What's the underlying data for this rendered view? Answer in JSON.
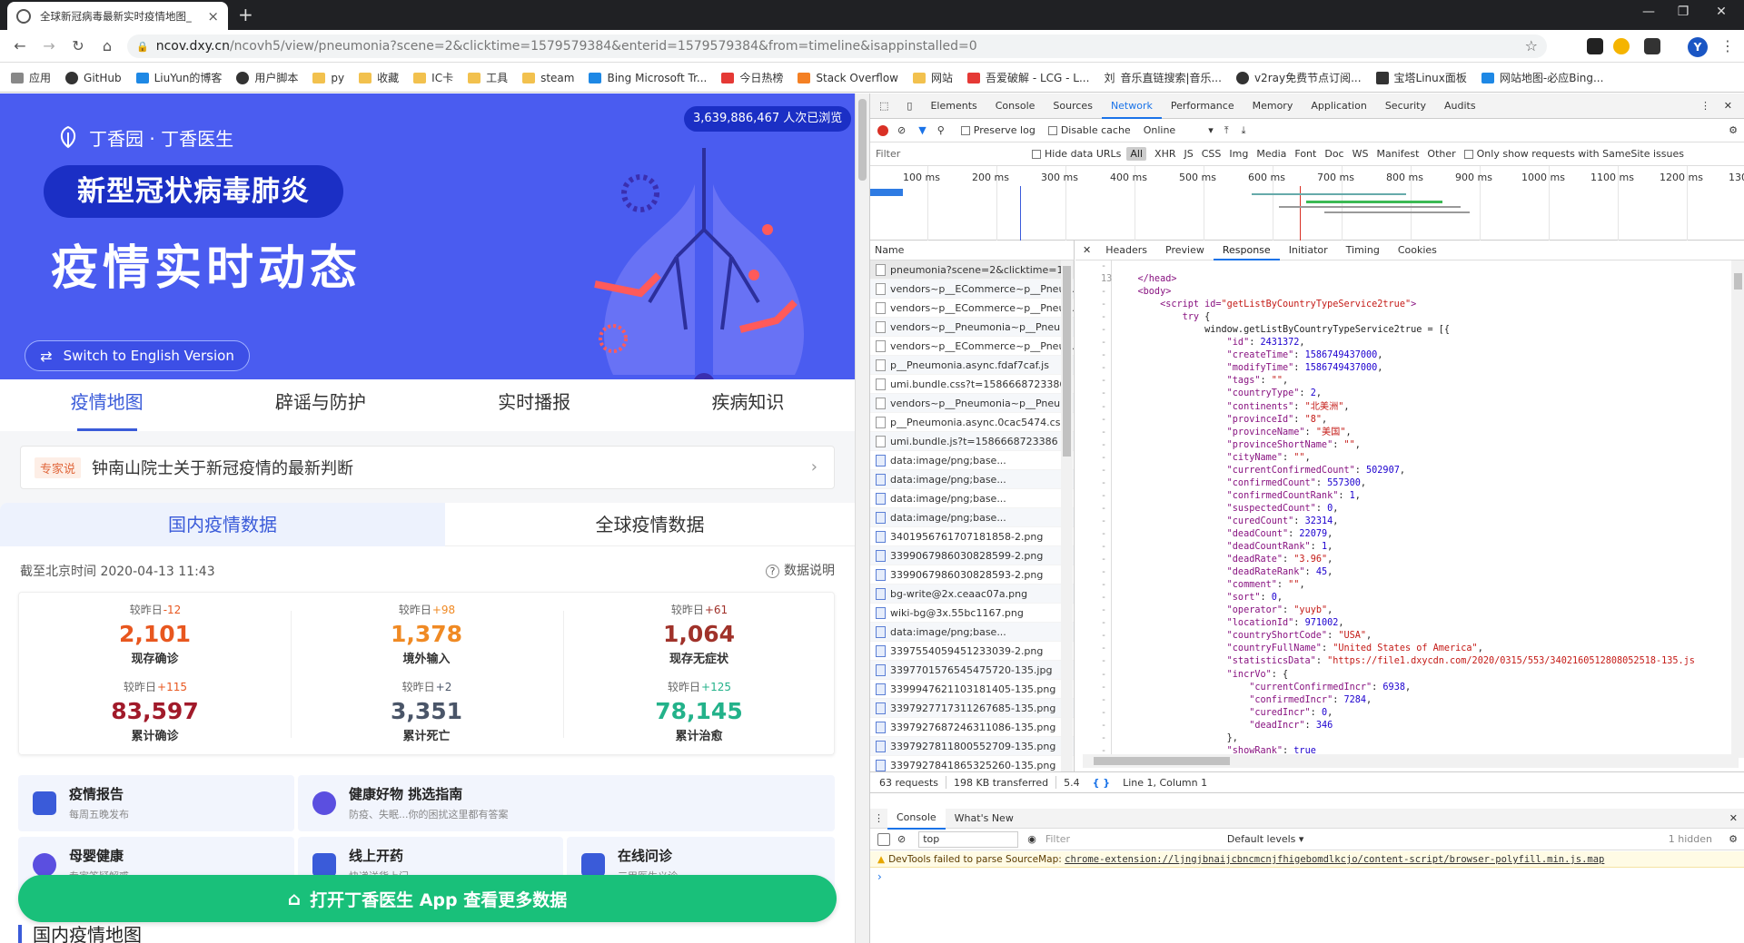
{
  "browser": {
    "tab_title": "全球新冠病毒最新实时疫情地图_",
    "url_host": "ncov.dxy.cn",
    "url_rest": "/ncovh5/view/pneumonia?scene=2&clicktime=1579579384&enterid=1579579384&from=timeline&isappinstalled=0",
    "avatar_letter": "Y",
    "bookmarks": [
      "应用",
      "GitHub",
      "LiuYun的博客",
      "用户脚本",
      "py",
      "收藏",
      "IC卡",
      "工具",
      "steam",
      "Bing Microsoft Tr...",
      "今日热榜",
      "Stack Overflow",
      "网站",
      "吾爱破解 - LCG - L...",
      "音乐直链搜索|音乐...",
      "v2ray免费节点订阅...",
      "宝塔Linux面板",
      "网站地图-必应Bing..."
    ],
    "bookmark_prefix_10": "刘"
  },
  "hero": {
    "logo_text": "丁香园 · 丁香医生",
    "pill_title": "新型冠状病毒肺炎",
    "big_title": "疫情实时动态",
    "view_count": "3,639,886,467 人次已浏览",
    "english_button": "Switch to English Version"
  },
  "nav_tabs": [
    "疫情地图",
    "辟谣与防护",
    "实时播报",
    "疾病知识"
  ],
  "expert": {
    "tag": "专家说",
    "text": "钟南山院士关于新冠疫情的最新判断"
  },
  "data_tabs": [
    "国内疫情数据",
    "全球疫情数据"
  ],
  "as_of": "截至北京时间 2020-04-13 11:43",
  "explain": "数据说明",
  "stats": [
    {
      "prefix": "较昨日",
      "delta": "-12",
      "value": "2,101",
      "label": "现存确诊",
      "color": "#e8571f",
      "dcolor": "#e8571f"
    },
    {
      "prefix": "较昨日",
      "delta": "+98",
      "value": "1,378",
      "label": "境外输入",
      "color": "#f08a24",
      "dcolor": "#f08a24"
    },
    {
      "prefix": "较昨日",
      "delta": "+61",
      "value": "1,064",
      "label": "现存无症状",
      "color": "#a0322a",
      "dcolor": "#a0322a"
    },
    {
      "prefix": "较昨日",
      "delta": "+115",
      "value": "83,597",
      "label": "累计确诊",
      "color": "#a11a2a",
      "dcolor": "#e8571f"
    },
    {
      "prefix": "较昨日",
      "delta": "+2",
      "value": "3,351",
      "label": "累计死亡",
      "color": "#4a5568",
      "dcolor": "#4a5568"
    },
    {
      "prefix": "较昨日",
      "delta": "+125",
      "value": "78,145",
      "label": "累计治愈",
      "color": "#23b28a",
      "dcolor": "#23b28a"
    }
  ],
  "services": [
    {
      "title": "疫情报告",
      "desc": "每周五晚发布",
      "color": "#3a5bd9"
    },
    {
      "title": "健康好物 挑选指南",
      "desc": "防疫、失眠...你的困扰这里都有答案",
      "color": "#3a5bd9"
    },
    {
      "title": "母婴健康",
      "desc": "专家答疑解惑",
      "color": "#3a5bd9"
    },
    {
      "title": "线上开药",
      "desc": "快递送货上门",
      "color": "#3a5bd9"
    },
    {
      "title": "在线问诊",
      "desc": "三甲医生义诊",
      "color": "#3a5bd9"
    }
  ],
  "open_app": "打开丁香医生 App 查看更多数据",
  "map_title": "国内疫情地图",
  "devtools": {
    "tabs": [
      "Elements",
      "Console",
      "Sources",
      "Network",
      "Performance",
      "Memory",
      "Application",
      "Security",
      "Audits"
    ],
    "active_tab": "Network",
    "preserve_log": "Preserve log",
    "disable_cache": "Disable cache",
    "throttle": "Online",
    "filter_placeholder": "Filter",
    "hide_data_urls": "Hide data URLs",
    "types": [
      "All",
      "XHR",
      "JS",
      "CSS",
      "Img",
      "Media",
      "Font",
      "Doc",
      "WS",
      "Manifest",
      "Other"
    ],
    "samesite": "Only show requests with SameSite issues",
    "ticks": [
      "100 ms",
      "200 ms",
      "300 ms",
      "400 ms",
      "500 ms",
      "600 ms",
      "700 ms",
      "800 ms",
      "900 ms",
      "1000 ms",
      "1100 ms",
      "1200 ms",
      "130"
    ],
    "name_header": "Name",
    "requests": [
      "pneumonia?scene=2&clicktime=1...",
      "vendors~p__ECommerce~p__Pneu...",
      "vendors~p__ECommerce~p__Pneu...",
      "vendors~p__Pneumonia~p__Pneu...",
      "vendors~p__ECommerce~p__Pneu...",
      "p__Pneumonia.async.fdaf7caf.js",
      "umi.bundle.css?t=1586668723386",
      "vendors~p__Pneumonia~p__Pneu...",
      "p__Pneumonia.async.0cac5474.css",
      "umi.bundle.js?t=1586668723386",
      "data:image/png;base...",
      "data:image/png;base...",
      "data:image/png;base...",
      "data:image/png;base...",
      "3401956761707181858-2.png",
      "3399067986030828599-2.png",
      "3399067986030828593-2.png",
      "bg-write@2x.ceaac07a.png",
      "wiki-bg@3x.55bc1167.png",
      "data:image/png;base...",
      "3397554059451233039-2.png",
      "3397701576545475720-135.jpg",
      "3399947621103181405-135.png",
      "3397927717311267685-135.png",
      "3397927687246311086-135.png",
      "3397927811800552709-135.png",
      "3397927841865325260-135.png"
    ],
    "detail_tabs": [
      "Headers",
      "Preview",
      "Response",
      "Initiator",
      "Timing",
      "Cookies"
    ],
    "active_detail": "Response",
    "line_number": "13",
    "status_requests": "63 requests",
    "status_transferred": "198 KB transferred",
    "status_extra": "5.4",
    "cursor_pos": "Line 1, Column 1",
    "console_tabs": [
      "Console",
      "What's New"
    ],
    "context": "top",
    "console_filter": "Filter",
    "levels": "Default levels ▾",
    "hidden": "1 hidden",
    "warning_text": "DevTools failed to parse SourceMap: ",
    "warning_link": "chrome-extension://ljngjbnaijcbncmcnjfhigebomdlkcjo/content-script/browser-polyfill.min.js.map"
  }
}
